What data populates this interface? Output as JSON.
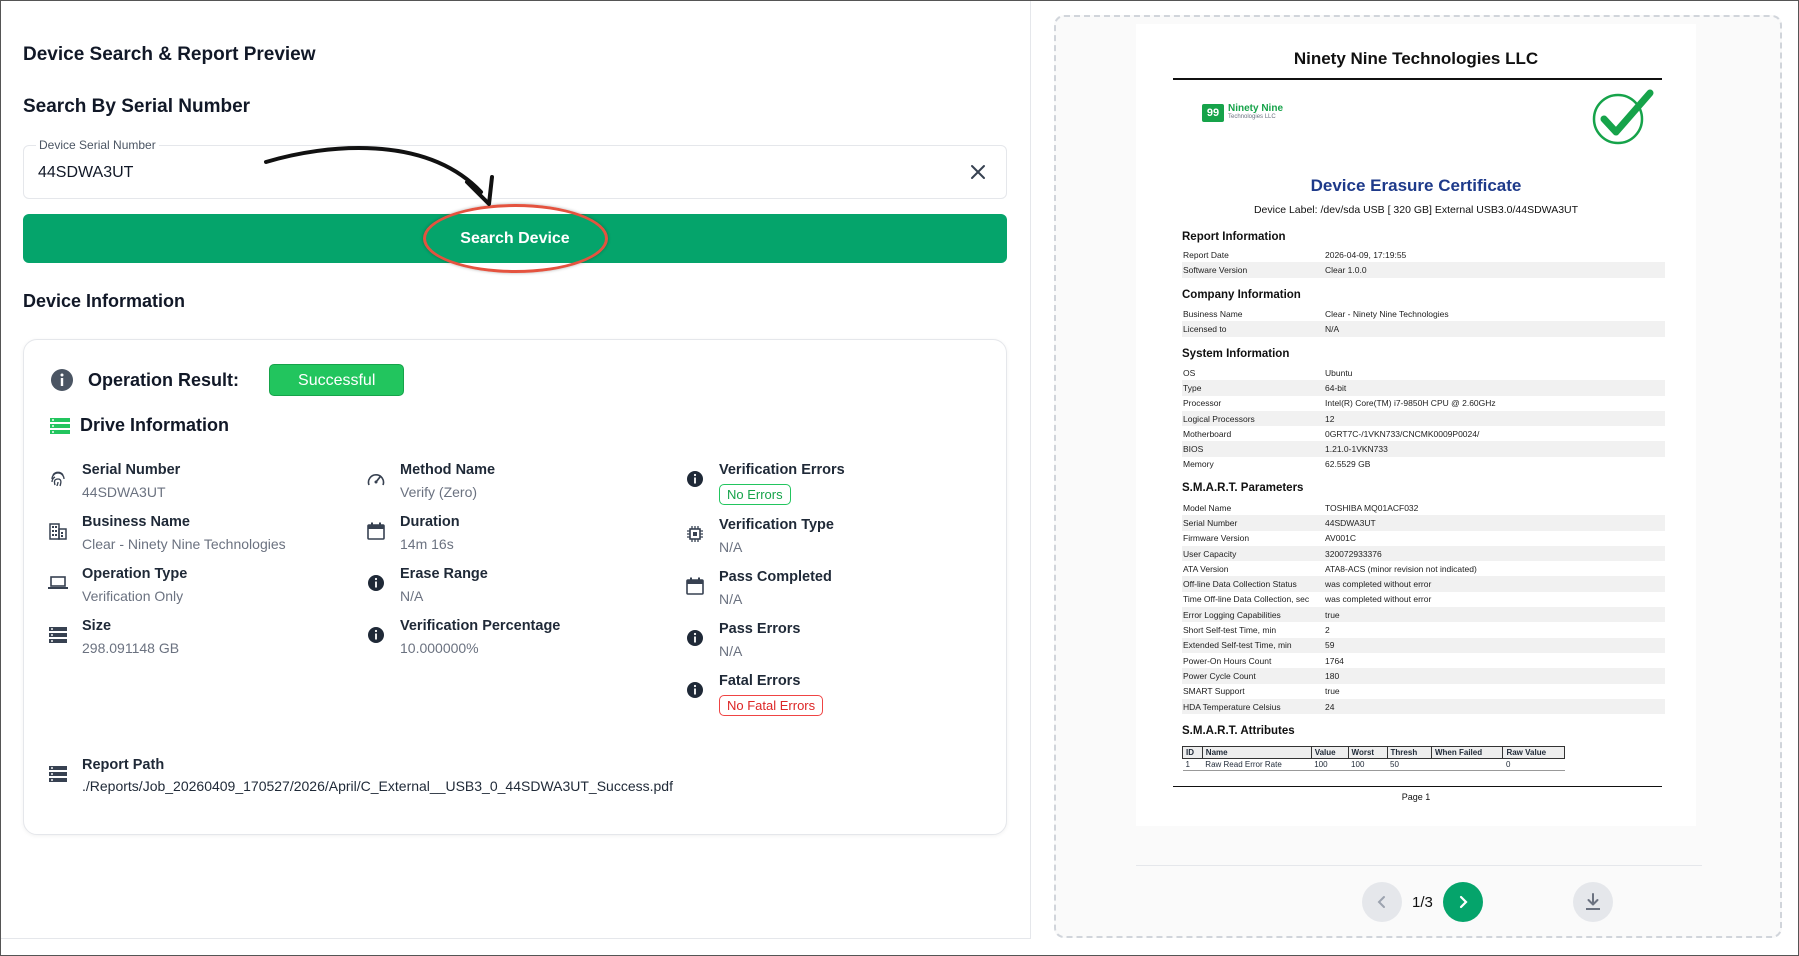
{
  "page_title": "Device Search & Report Preview",
  "search": {
    "heading": "Search By Serial Number",
    "field_label": "Device Serial Number",
    "value": "44SDWA3UT",
    "button_label": "Search Device"
  },
  "device_info": {
    "heading": "Device Information",
    "operation_result_label": "Operation Result:",
    "operation_result_value": "Successful",
    "drive_info_heading": "Drive Information",
    "col1": [
      {
        "label": "Serial Number",
        "value": "44SDWA3UT",
        "icon": "fingerprint-icon"
      },
      {
        "label": "Business Name",
        "value": "Clear - Ninety Nine Technologies",
        "icon": "building-icon"
      },
      {
        "label": "Operation Type",
        "value": "Verification Only",
        "icon": "laptop-icon"
      },
      {
        "label": "Size",
        "value": "298.091148 GB",
        "icon": "storage-icon"
      }
    ],
    "col2": [
      {
        "label": "Method Name",
        "value": "Verify (Zero)",
        "icon": "speedometer-icon"
      },
      {
        "label": "Duration",
        "value": "14m 16s",
        "icon": "calendar-icon"
      },
      {
        "label": "Erase Range",
        "value": "N/A",
        "icon": "info-icon"
      },
      {
        "label": "Verification Percentage",
        "value": "10.000000%",
        "icon": "info-icon"
      }
    ],
    "col3": {
      "verification_errors": {
        "label": "Verification Errors",
        "value": "No Errors"
      },
      "verification_type": {
        "label": "Verification Type",
        "value": "N/A"
      },
      "pass_completed": {
        "label": "Pass Completed",
        "value": "N/A"
      },
      "pass_errors": {
        "label": "Pass Errors",
        "value": "N/A"
      },
      "fatal_errors": {
        "label": "Fatal Errors",
        "value": "No Fatal Errors"
      }
    },
    "report_path": {
      "label": "Report Path",
      "value": "./Reports/Job_20260409_170527/2026/April/C_External__USB3_0_44SDWA3UT_Success.pdf"
    }
  },
  "pdf": {
    "company": "Ninety Nine Technologies LLC",
    "logo_mark": "99",
    "logo_name": "Ninety Nine",
    "logo_sub": "Technologies LLC",
    "title": "Device Erasure Certificate",
    "device_label": "Device Label: /dev/sda  USB     [ 320 GB] External  USB3.0/44SDWA3UT",
    "sections": {
      "report": {
        "title": "Report Information",
        "rows": [
          [
            "Report Date",
            "2026-04-09, 17:19:55"
          ],
          [
            "Software Version",
            "Clear 1.0.0"
          ]
        ]
      },
      "company": {
        "title": "Company Information",
        "rows": [
          [
            "Business Name",
            "Clear - Ninety Nine Technologies"
          ],
          [
            "Licensed to",
            "N/A"
          ]
        ]
      },
      "system": {
        "title": "System Information",
        "rows": [
          [
            "OS",
            "Ubuntu"
          ],
          [
            "Type",
            "64-bit"
          ],
          [
            "Processor",
            "Intel(R) Core(TM) i7-9850H CPU @ 2.60GHz"
          ],
          [
            "Logical Processors",
            "12"
          ],
          [
            "Motherboard",
            "0GRT7C-/1VKN733/CNCMK0009P0024/"
          ],
          [
            "BIOS",
            "1.21.0-1VKN733"
          ],
          [
            "Memory",
            "62.5529 GB"
          ]
        ]
      },
      "smart": {
        "title": "S.M.A.R.T. Parameters",
        "rows": [
          [
            "Model Name",
            "TOSHIBA MQ01ACF032"
          ],
          [
            "Serial Number",
            "44SDWA3UT"
          ],
          [
            "Firmware Version",
            "AV001C"
          ],
          [
            "User Capacity",
            "320072933376"
          ],
          [
            "ATA Version",
            "ATA8-ACS (minor revision not indicated)"
          ],
          [
            "Off-line Data Collection Status",
            "was completed without error"
          ],
          [
            "Time Off-line Data Collection, sec",
            "was completed without error"
          ],
          [
            "Error Logging Capabilities",
            "true"
          ],
          [
            "Short Self-test Time, min",
            "2"
          ],
          [
            "Extended Self-test Time, min",
            "59"
          ],
          [
            "Power-On Hours Count",
            "1764"
          ],
          [
            "Power Cycle Count",
            "180"
          ],
          [
            "SMART Support",
            "true"
          ],
          [
            "HDA Temperature Celsius",
            "24"
          ]
        ]
      }
    },
    "attributes": {
      "title": "S.M.A.R.T. Attributes",
      "headers": [
        "ID",
        "Name",
        "Value",
        "Worst",
        "Thresh",
        "When Failed",
        "Raw Value"
      ],
      "rows": [
        [
          "1",
          "Raw Read Error Rate",
          "100",
          "100",
          "50",
          "",
          "0"
        ]
      ]
    },
    "page_label": "Page 1"
  },
  "pager": {
    "text": "1/3"
  },
  "colors": {
    "accent": "#05a46b",
    "success": "#22c55e",
    "error": "#ef4444",
    "pdf_title": "#1e3a8a"
  }
}
